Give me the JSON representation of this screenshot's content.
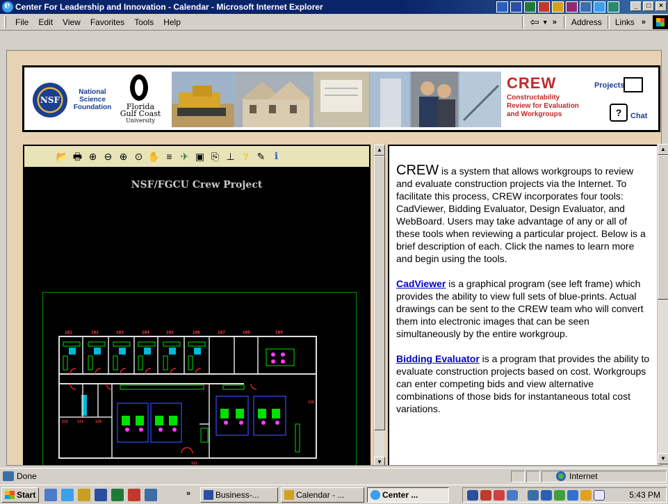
{
  "window": {
    "title": "Center For Leadership and Innovation - Calendar - Microsoft Internet Explorer",
    "controls": {
      "minimize": "_",
      "maximize": "□",
      "close": "×"
    }
  },
  "menu": {
    "items": [
      {
        "label": "File",
        "accel": "F"
      },
      {
        "label": "Edit",
        "accel": "E"
      },
      {
        "label": "View",
        "accel": "V"
      },
      {
        "label": "Favorites",
        "accel": "a"
      },
      {
        "label": "Tools",
        "accel": "T"
      },
      {
        "label": "Help",
        "accel": "H"
      }
    ],
    "chevron": "»",
    "address_label": "Address",
    "links_label": "Links"
  },
  "banner": {
    "nsf_seal": "NSF",
    "nsf_lines": [
      "National",
      "Science",
      "Foundation"
    ],
    "fgcu_lines": [
      "Florida",
      "Gulf Coast",
      "University"
    ],
    "crew_title": "CREW",
    "crew_sub": [
      "Constructability",
      "Review for Evaluation",
      "and Workgroups"
    ],
    "projects_label": "Projects",
    "chat_label": "Chat",
    "chat_glyph": "?"
  },
  "cad": {
    "title": "NSF/FGCU Crew Project",
    "toolbar_icons": [
      "open-folder-icon",
      "print-icon",
      "zoom-in-icon",
      "zoom-out-icon",
      "zoom-extents-icon",
      "zoom-window-icon",
      "pan-hand-icon",
      "layers-icon",
      "map-icon",
      "window-icon",
      "redraw-icon",
      "measure-icon",
      "help-icon",
      "markup-icon",
      "info-icon"
    ],
    "toolbar_glyphs": [
      "📂",
      "🖶",
      "⊕",
      "⊖",
      "⊕",
      "⊙",
      "✋",
      "≡",
      "✈",
      "▣",
      "⎘",
      "⊥",
      "?",
      "✎",
      "i"
    ],
    "room_labels": [
      "101",
      "102",
      "103",
      "104",
      "105",
      "106",
      "107",
      "108",
      "109"
    ]
  },
  "content": {
    "intro_lead": "CREW",
    "intro_rest": " is a system that allows workgroups to review and evaluate construction projects via the Internet. To facilitate this process, CREW incorporates four tools: CadViewer, Bidding Evaluator, Design Evaluator, and WebBoard. Users may take advantage of any or all of these tools when reviewing a particular project. Below is a brief description of each. Click the names to learn more and begin using the tools.",
    "cadviewer_link": "CadViewer",
    "cadviewer_text": " is a graphical program (see left frame) which provides the ability to view full sets of blue-prints. Actual drawings can be sent to the CREW team who will convert them into electronic images that can be seen simultaneously by the entire workgroup.",
    "bidding_link": "Bidding Evaluator",
    "bidding_text": " is a program that provides the ability to evaluate construction projects based on cost. Workgroups can enter competing bids and view alternative combinations of those bids for instantaneous total cost variations."
  },
  "statusbar": {
    "status": "Done",
    "zone": "Internet"
  },
  "taskbar": {
    "start_label": "Start",
    "chevron": "»",
    "buttons": [
      {
        "label": "Business-...",
        "active": false
      },
      {
        "label": "Calendar - ...",
        "active": false
      },
      {
        "label": "Center ...",
        "active": true
      }
    ],
    "clock": "5:43 PM"
  },
  "colors": {
    "title_bar": "#0a246a",
    "page_background": "#e7d2b1",
    "link": "#0000cc",
    "crew_red": "#c0282a",
    "cad_background": "#000000",
    "cad_toolbar": "#e8e4b8"
  }
}
